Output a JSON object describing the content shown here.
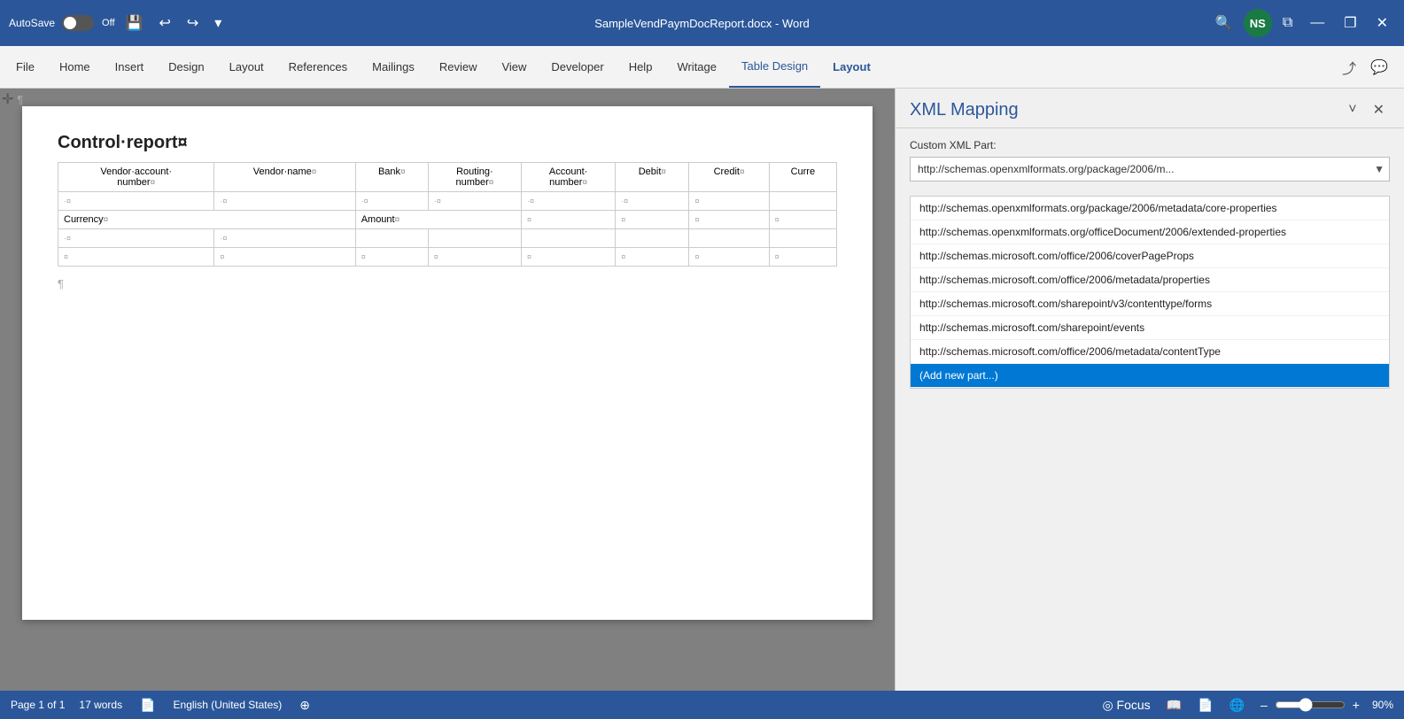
{
  "titleBar": {
    "autosave": "AutoSave",
    "toggleState": "Off",
    "fileName": "SampleVendPaymDocReport.docx",
    "separator": "–",
    "appName": "Word",
    "avatarInitials": "NS",
    "windowControls": {
      "minimize": "—",
      "restore": "❐",
      "close": "✕"
    }
  },
  "ribbon": {
    "tabs": [
      {
        "id": "file",
        "label": "File"
      },
      {
        "id": "home",
        "label": "Home"
      },
      {
        "id": "insert",
        "label": "Insert"
      },
      {
        "id": "design",
        "label": "Design"
      },
      {
        "id": "layout",
        "label": "Layout"
      },
      {
        "id": "references",
        "label": "References"
      },
      {
        "id": "mailings",
        "label": "Mailings"
      },
      {
        "id": "review",
        "label": "Review"
      },
      {
        "id": "view",
        "label": "View"
      },
      {
        "id": "developer",
        "label": "Developer"
      },
      {
        "id": "help",
        "label": "Help"
      },
      {
        "id": "writage",
        "label": "Writage"
      },
      {
        "id": "tabledesign",
        "label": "Table Design",
        "active": true
      },
      {
        "id": "tablelayout",
        "label": "Layout",
        "blue": true
      }
    ],
    "shareIcon": "⤴",
    "commentsIcon": "💬"
  },
  "document": {
    "title": "Control·report¤",
    "paragraphMark": "¶",
    "table": {
      "headers": [
        "Vendor·account·number¤",
        "Vendor·name¤",
        "Bank¤",
        "Routing·number¤",
        "Account·number¤",
        "Debit¤",
        "Credit¤",
        "Curre"
      ],
      "subHeaders": [
        "Currency¤",
        "Amount¤"
      ],
      "marks": "¤"
    }
  },
  "xmlPanel": {
    "title": "XML Mapping",
    "closeBtn": "✕",
    "collapseBtn": "˅",
    "label": "Custom XML Part:",
    "selectedValue": "http://schemas.openxmlformats.org/package/2006/m...",
    "options": [
      "http://schemas.openxmlformats.org/package/2006/metadata/core-properties",
      "http://schemas.openxmlformats.org/officeDocument/2006/extended-properties",
      "http://schemas.microsoft.com/office/2006/coverPageProps",
      "http://schemas.microsoft.com/office/2006/metadata/properties",
      "http://schemas.microsoft.com/sharepoint/v3/contenttype/forms",
      "http://schemas.microsoft.com/sharepoint/events",
      "http://schemas.microsoft.com/office/2006/metadata/contentType",
      "(Add new part...)"
    ],
    "selectedOption": "(Add new part...)"
  },
  "statusBar": {
    "pageInfo": "Page 1 of 1",
    "wordCount": "17 words",
    "language": "English (United States)",
    "focusLabel": "Focus",
    "zoomLevel": "90%",
    "zoomMinus": "–",
    "zoomPlus": "+"
  }
}
